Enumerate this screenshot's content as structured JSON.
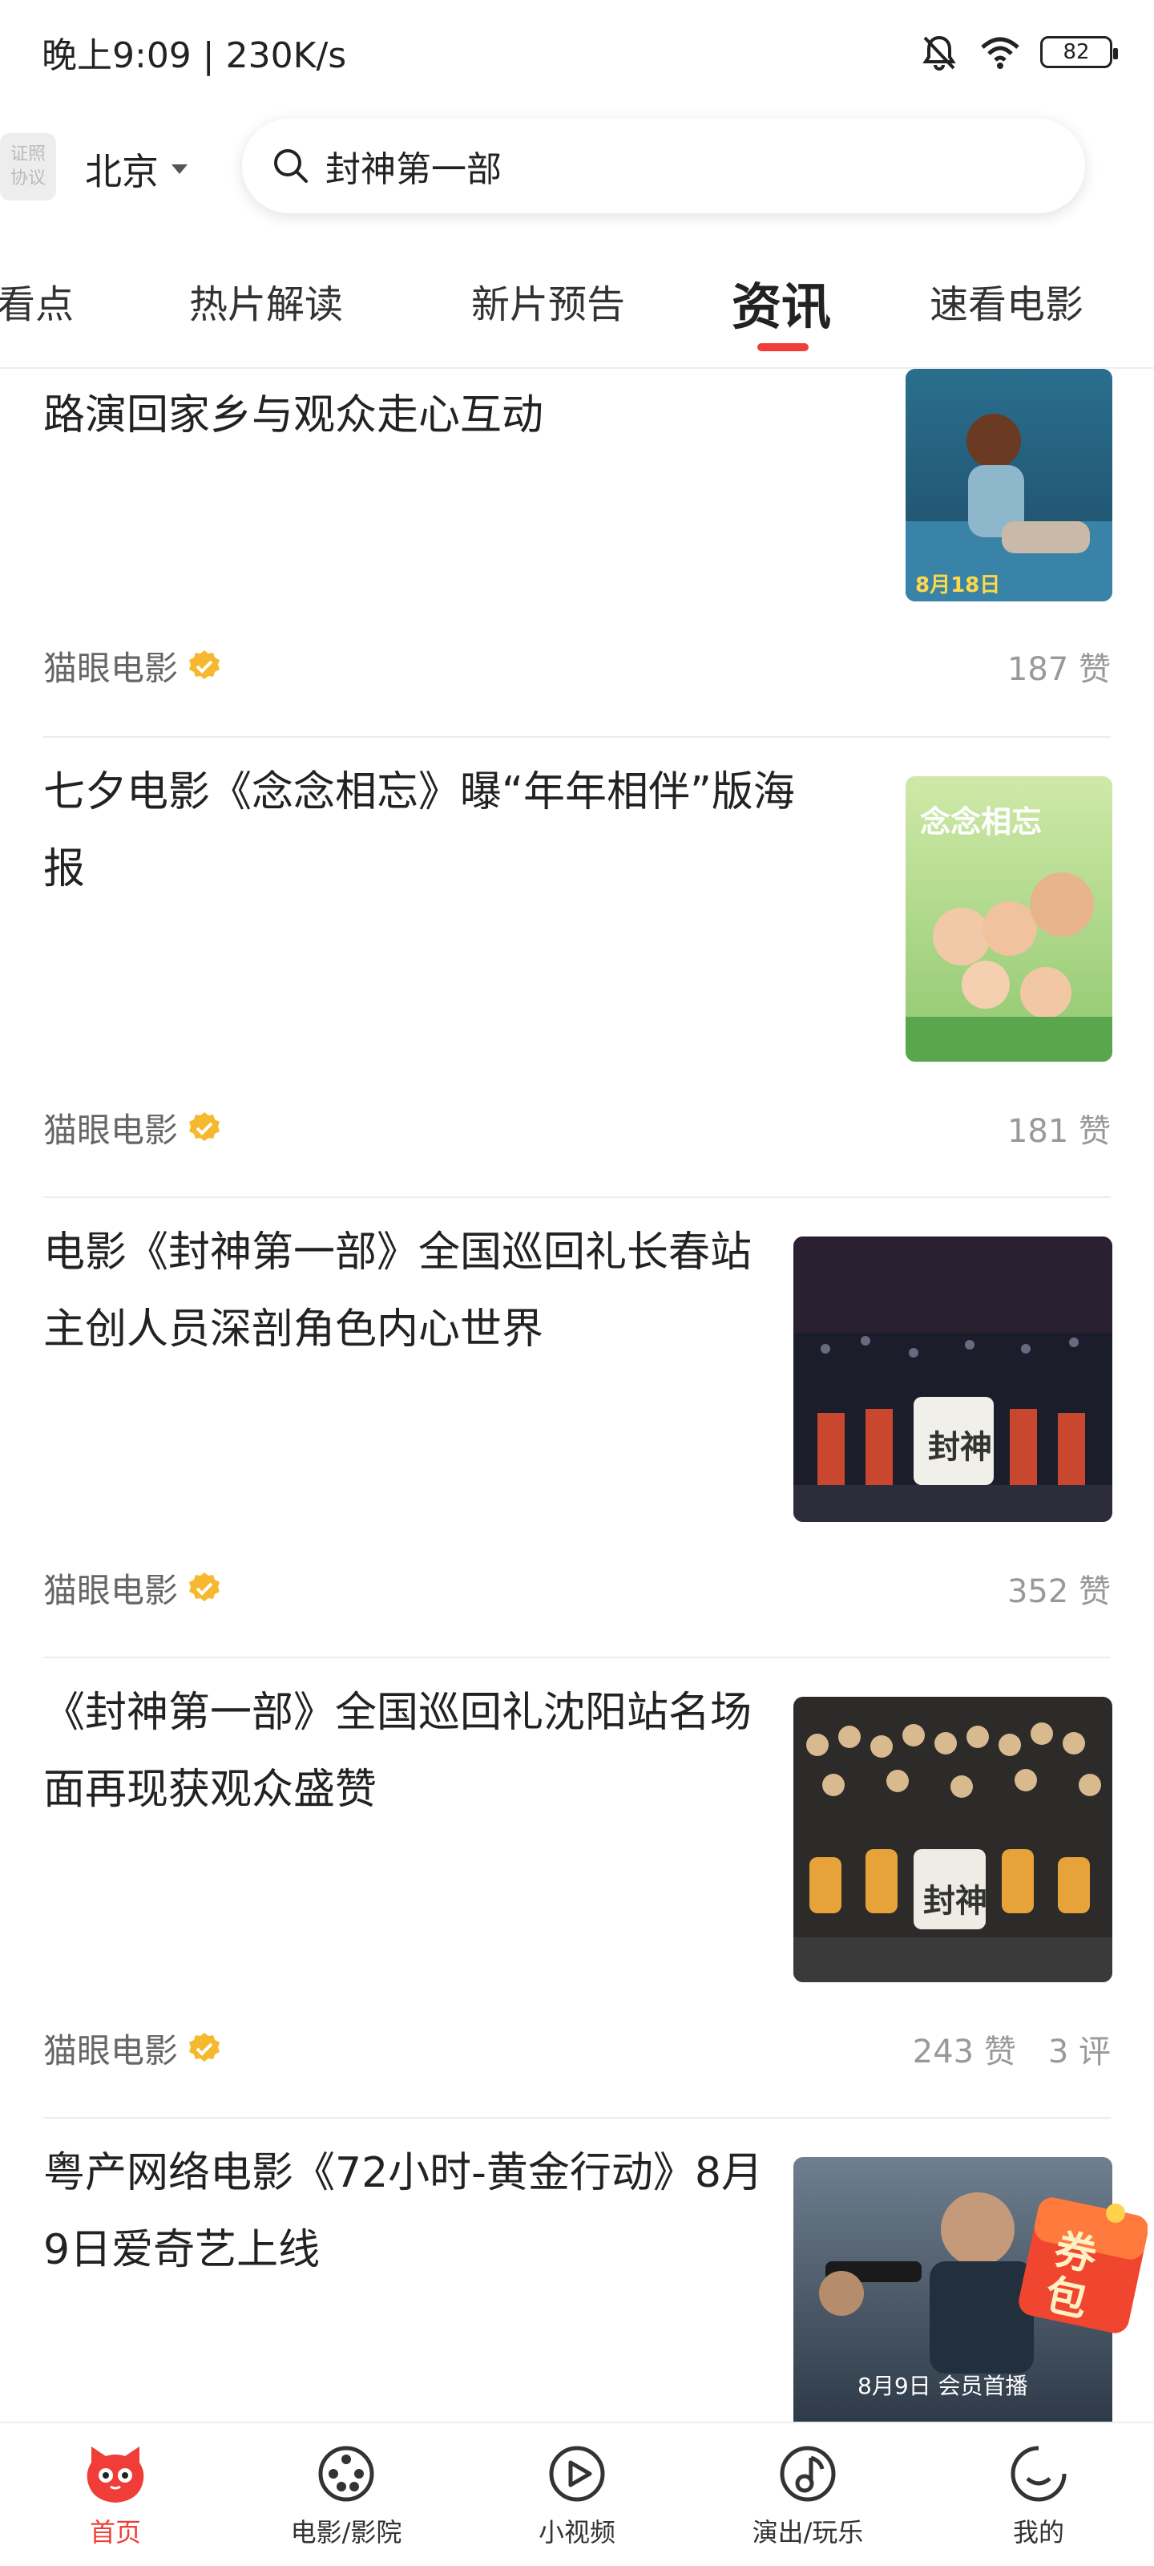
{
  "status_bar": {
    "time": "晚上9:09 | 230K/s",
    "battery": "82"
  },
  "header": {
    "cert_badge": [
      "证照",
      "协议"
    ],
    "city": "北京",
    "search_value": "封神第一部"
  },
  "tabs": [
    {
      "label": "看点"
    },
    {
      "label": "热片解读"
    },
    {
      "label": "新片预告"
    },
    {
      "label": "资讯",
      "active": true
    },
    {
      "label": "速看电影"
    }
  ],
  "feed": [
    {
      "title": "路演回家乡与观众走心互动",
      "thumb_caption": "8月18日",
      "source": "猫眼电影",
      "likes": "187 赞",
      "comments": ""
    },
    {
      "title": "七夕电影《念念相忘》曝“年年相伴”版海报",
      "thumb_caption": "念念相忘",
      "source": "猫眼电影",
      "likes": "181 赞",
      "comments": ""
    },
    {
      "title": "电影《封神第一部》全国巡回礼长春站 主创人员深剖角色内心世界",
      "thumb_caption": "封神",
      "source": "猫眼电影",
      "likes": "352 赞",
      "comments": ""
    },
    {
      "title": "《封神第一部》全国巡回礼沈阳站名场面再现获观众盛赞",
      "thumb_caption": "封神",
      "source": "猫眼电影",
      "likes": "243 赞",
      "comments": "3 评"
    },
    {
      "title": "粤产网络电影《72小时-黄金行动》8月9日爱奇艺上线",
      "thumb_caption": "8月9日 会员首播",
      "source": "",
      "likes": "",
      "comments": ""
    }
  ],
  "coupon": {
    "label": "券包"
  },
  "bottom_nav": [
    {
      "label": "首页",
      "icon": "cat-face-icon",
      "active": true
    },
    {
      "label": "电影/影院",
      "icon": "film-reel-icon"
    },
    {
      "label": "小视频",
      "icon": "play-circle-icon"
    },
    {
      "label": "演出/玩乐",
      "icon": "music-note-icon"
    },
    {
      "label": "我的",
      "icon": "profile-circle-icon"
    }
  ],
  "colors": {
    "accent": "#f03d37",
    "verified": "#f5b82e",
    "text_primary": "#222222",
    "text_secondary": "#999999"
  }
}
